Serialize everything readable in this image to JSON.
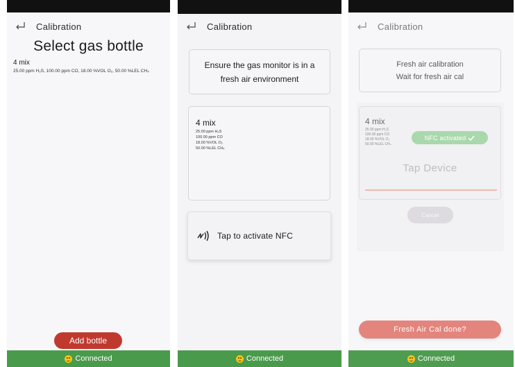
{
  "screens": {
    "select": {
      "title": "Calibration",
      "heading": "Select gas bottle",
      "gas": {
        "name": "4 mix",
        "detail": "25.00 ppm H₂S, 100.00 ppm CO, 18.00 %VOL O₂, 50.00 %LEL CH₄"
      },
      "add_button": "Add bottle",
      "status": "Connected"
    },
    "activate": {
      "title": "Calibration",
      "instruction": "Ensure the gas monitor is in a fresh air environment",
      "gas": {
        "name": "4 mix",
        "lines": [
          "25.00 ppm H₂S",
          "100.00 ppm CO",
          "18.00 %VOL O₂",
          "50.00 %LEL CH₄"
        ]
      },
      "nfc_label": "Tap to activate NFC",
      "status": "Connected"
    },
    "tap": {
      "title": "Calibration",
      "instruction_line1": "Fresh air calibration",
      "instruction_line2": "Wait for fresh air cal",
      "gas": {
        "name": "4 mix",
        "lines": [
          "25.00 ppm H₂S",
          "100.00 ppm CO",
          "18.00 %VOL O₂",
          "50.00 %LEL CH₄"
        ]
      },
      "nfc_badge": "NFC activated",
      "tap_prompt": "Tap Device",
      "cancel_label": "Cancel",
      "done_label": "Fresh Air Cal done?",
      "status": "Connected"
    }
  },
  "icons": {
    "back": "return-arrow-icon",
    "nfc": "nfc-icon",
    "check": "check-icon",
    "status": "smiley-icon"
  },
  "colors": {
    "accent_red": "#c0392f",
    "status_green": "#4a9a4c",
    "nfc_badge_green": "#a9d8ac"
  }
}
